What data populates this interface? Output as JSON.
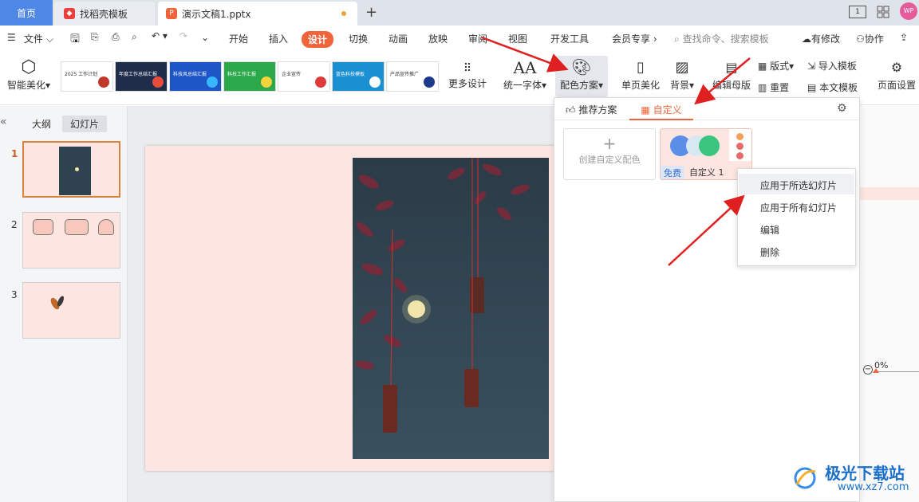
{
  "tabs": {
    "home": "首页",
    "template": "找稻壳模板",
    "doc": "演示文稿1.pptx",
    "new_tab": "+",
    "user_badge": "WP"
  },
  "menu": {
    "file": "文件",
    "items": [
      "开始",
      "插入",
      "设计",
      "切换",
      "动画",
      "放映",
      "审阅",
      "视图",
      "开发工具",
      "会员专享"
    ],
    "search_placeholder": "查找命令、搜索模板",
    "modified": "有修改",
    "collab": "协作"
  },
  "ribbon": {
    "smart": "智能美化",
    "more_design": "更多设计",
    "unify_font": "统一字体",
    "color_scheme": "配色方案",
    "single_page": "单页美化",
    "background": "背景",
    "edit_master": "编辑母版",
    "layout": "版式",
    "reset": "重置",
    "import_template": "导入模板",
    "text_template": "本文模板",
    "page_setup": "页面设置",
    "thumbs": [
      {
        "text": "2025 工作计划",
        "color": "#ffffff",
        "accent": "#c0392b"
      },
      {
        "text": "年度工作总结汇报",
        "color": "#1f2d4b",
        "accent": "#e74c3c"
      },
      {
        "text": "科技风总结汇报",
        "color": "#1e56c8",
        "accent": "#38b6ff"
      },
      {
        "text": "科技工作汇报",
        "color": "#2ba84a",
        "accent": "#f5d33c"
      },
      {
        "text": "企业宣传",
        "color": "#ffffff",
        "accent": "#e03b3b"
      },
      {
        "text": "蓝色科技模板",
        "color": "#1a8fd1",
        "accent": "#ffffff"
      },
      {
        "text": "产品宣传推广",
        "color": "#ffffff",
        "accent": "#1b3a8c"
      }
    ]
  },
  "left": {
    "outline_tab": "大纲",
    "slides_tab": "幻灯片",
    "slide_nums": [
      "1",
      "2",
      "3"
    ]
  },
  "scheme_panel": {
    "tab_recommend": "推荐方案",
    "tab_custom": "自定义",
    "create_label": "创建自定义配色",
    "create_plus": "+",
    "custom1_name": "自定义 1",
    "free_badge": "免费",
    "swatches": [
      "#5b8ee6",
      "#d8e8f0",
      "#3bc47d"
    ],
    "dots": [
      "#f5a05a",
      "#e86a6a",
      "#e86a6a"
    ]
  },
  "context_menu": {
    "items": [
      "应用于所选幻灯片",
      "应用于所有幻灯片",
      "编辑",
      "删除"
    ]
  },
  "right": {
    "zoom_value": "0%"
  },
  "watermark": {
    "brand": "极光下载站",
    "url": "www.xz7.com"
  },
  "colors": {
    "accent_orange": "#f0643c",
    "tab_blue": "#4f87e6",
    "slide_bg": "#fde5e1",
    "arrow_red": "#e02020"
  }
}
